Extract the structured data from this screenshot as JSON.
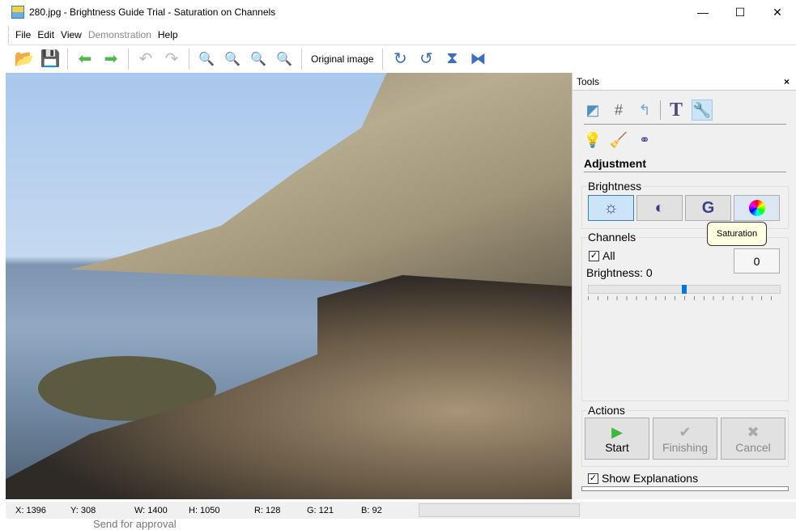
{
  "window": {
    "title": "280.jpg - Brightness Guide Trial - Saturation on Channels",
    "minimize": "—",
    "maximize": "☐",
    "close": "✕"
  },
  "menu": {
    "items": [
      {
        "label": "File"
      },
      {
        "label": "Edit"
      },
      {
        "label": "View"
      },
      {
        "label": "Demonstration",
        "disabled": true
      },
      {
        "label": "Help"
      }
    ]
  },
  "toolbar": {
    "original_image": "Original image"
  },
  "tools": {
    "title": "Tools",
    "close": "×",
    "section": "Adjustment",
    "brightness": {
      "label": "Brightness",
      "tooltip": "Saturation"
    },
    "channels": {
      "label": "Channels",
      "all_label": "All",
      "all_checked": true,
      "brightness_label": "Brightness: 0",
      "value": "0",
      "slider_value": 0
    },
    "actions": {
      "label": "Actions",
      "start": "Start",
      "finishing": "Finishing",
      "cancel": "Cancel"
    },
    "show_explanations": "Show Explanations",
    "show_explanations_checked": true
  },
  "status": {
    "x": "X: 1396",
    "y": "Y: 308",
    "w": "W: 1400",
    "h": "H: 1050",
    "r": "R: 128",
    "g": "G: 121",
    "b": "B: 92"
  },
  "background_text": "Send for approval"
}
